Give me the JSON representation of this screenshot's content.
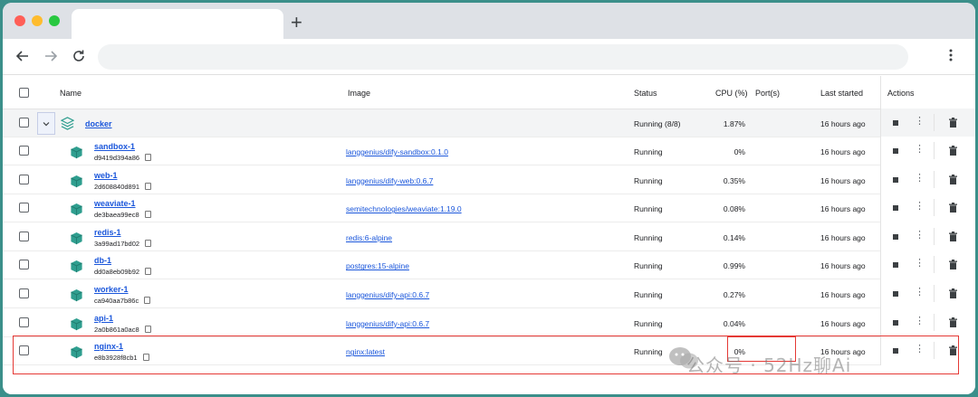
{
  "browser": {
    "new_tab_label": "+",
    "back_icon": "arrow-left-icon",
    "forward_icon": "arrow-right-icon",
    "reload_icon": "reload-icon",
    "menu_icon": "kebab-icon",
    "url": ""
  },
  "table": {
    "headers": {
      "name": "Name",
      "image": "Image",
      "status": "Status",
      "cpu": "CPU (%)",
      "ports": "Port(s)",
      "last_started": "Last started",
      "actions": "Actions"
    },
    "group": {
      "name": "docker",
      "status": "Running (8/8)",
      "cpu": "1.87%",
      "last_started": "16 hours ago"
    },
    "rows": [
      {
        "name": "sandbox-1",
        "id": "d9419d394a86",
        "image": "langgenius/dify-sandbox:0.1.0",
        "status": "Running",
        "cpu": "0%",
        "last_started": "16 hours ago"
      },
      {
        "name": "web-1",
        "id": "2d608840d891",
        "image": "langgenius/dify-web:0.6.7",
        "status": "Running",
        "cpu": "0.35%",
        "last_started": "16 hours ago"
      },
      {
        "name": "weaviate-1",
        "id": "de3baea99ec8",
        "image": "semitechnologies/weaviate:1.19.0",
        "status": "Running",
        "cpu": "0.08%",
        "last_started": "16 hours ago"
      },
      {
        "name": "redis-1",
        "id": "3a99ad17bd02",
        "image": "redis:6-alpine",
        "status": "Running",
        "cpu": "0.14%",
        "last_started": "16 hours ago"
      },
      {
        "name": "db-1",
        "id": "dd0a8eb09b92",
        "image": "postgres:15-alpine",
        "status": "Running",
        "cpu": "0.99%",
        "last_started": "16 hours ago"
      },
      {
        "name": "worker-1",
        "id": "ca940aa7b86c",
        "image": "langgenius/dify-api:0.6.7",
        "status": "Running",
        "cpu": "0.27%",
        "last_started": "16 hours ago"
      },
      {
        "name": "api-1",
        "id": "2a0b861a0ac8",
        "image": "langgenius/dify-api:0.6.7",
        "status": "Running",
        "cpu": "0.04%",
        "last_started": "16 hours ago"
      },
      {
        "name": "nginx-1",
        "id": "e8b3928f8cb1",
        "image": "nginx:latest",
        "status": "Running",
        "cpu": "0%",
        "last_started": "16 hours ago"
      }
    ]
  },
  "watermark": "公众号 · 52Hz聊Ai",
  "colors": {
    "link": "#1a56db",
    "highlight": "#e53935",
    "cube": "#2f9e8f"
  }
}
